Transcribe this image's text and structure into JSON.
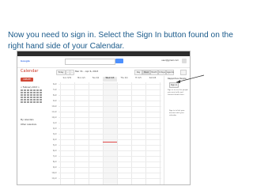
{
  "caption": "Now you need to sign in. Select the Sign In button found on the right hand side of your Calendar.",
  "colors": {
    "caption": "#1a5a8a",
    "create": "#d14836",
    "search": "#4d90fe",
    "now_line": "#e04848",
    "arrow": "#333333"
  },
  "calendar": {
    "brand": "Calendar",
    "create_label": "CREATE",
    "today_label": "Today",
    "date_range": "Mar 31 – Apr 6, 2013",
    "views": [
      "Day",
      "Week",
      "Month",
      "4 Days",
      "Agenda"
    ],
    "active_view": "Week",
    "mini_title": "< February 2013 >",
    "left_sections": [
      "My calendars",
      "Other calendars"
    ],
    "days": [
      "Sun 3/31",
      "Mon 4/1",
      "Tue 4/2",
      "Wed 4/3",
      "Thu 4/4",
      "Fri 4/5",
      "Sat 4/6"
    ],
    "selected_day_index": 3,
    "hours": [
      "6am",
      "7am",
      "8am",
      "9am",
      "10am",
      "11am",
      "12pm",
      "1pm",
      "2pm",
      "3pm",
      "4pm",
      "5pm",
      "6pm",
      "7pm",
      "8pm",
      "9pm",
      "10pm",
      "11pm"
    ],
    "right_panel": {
      "title": "Rapportive People",
      "signin_label": "Sign in",
      "description": "Sign in to see the people you meet with and contact details here.",
      "note": "Sign in to link your account with your calendar."
    },
    "account": "user@gmail.com"
  }
}
